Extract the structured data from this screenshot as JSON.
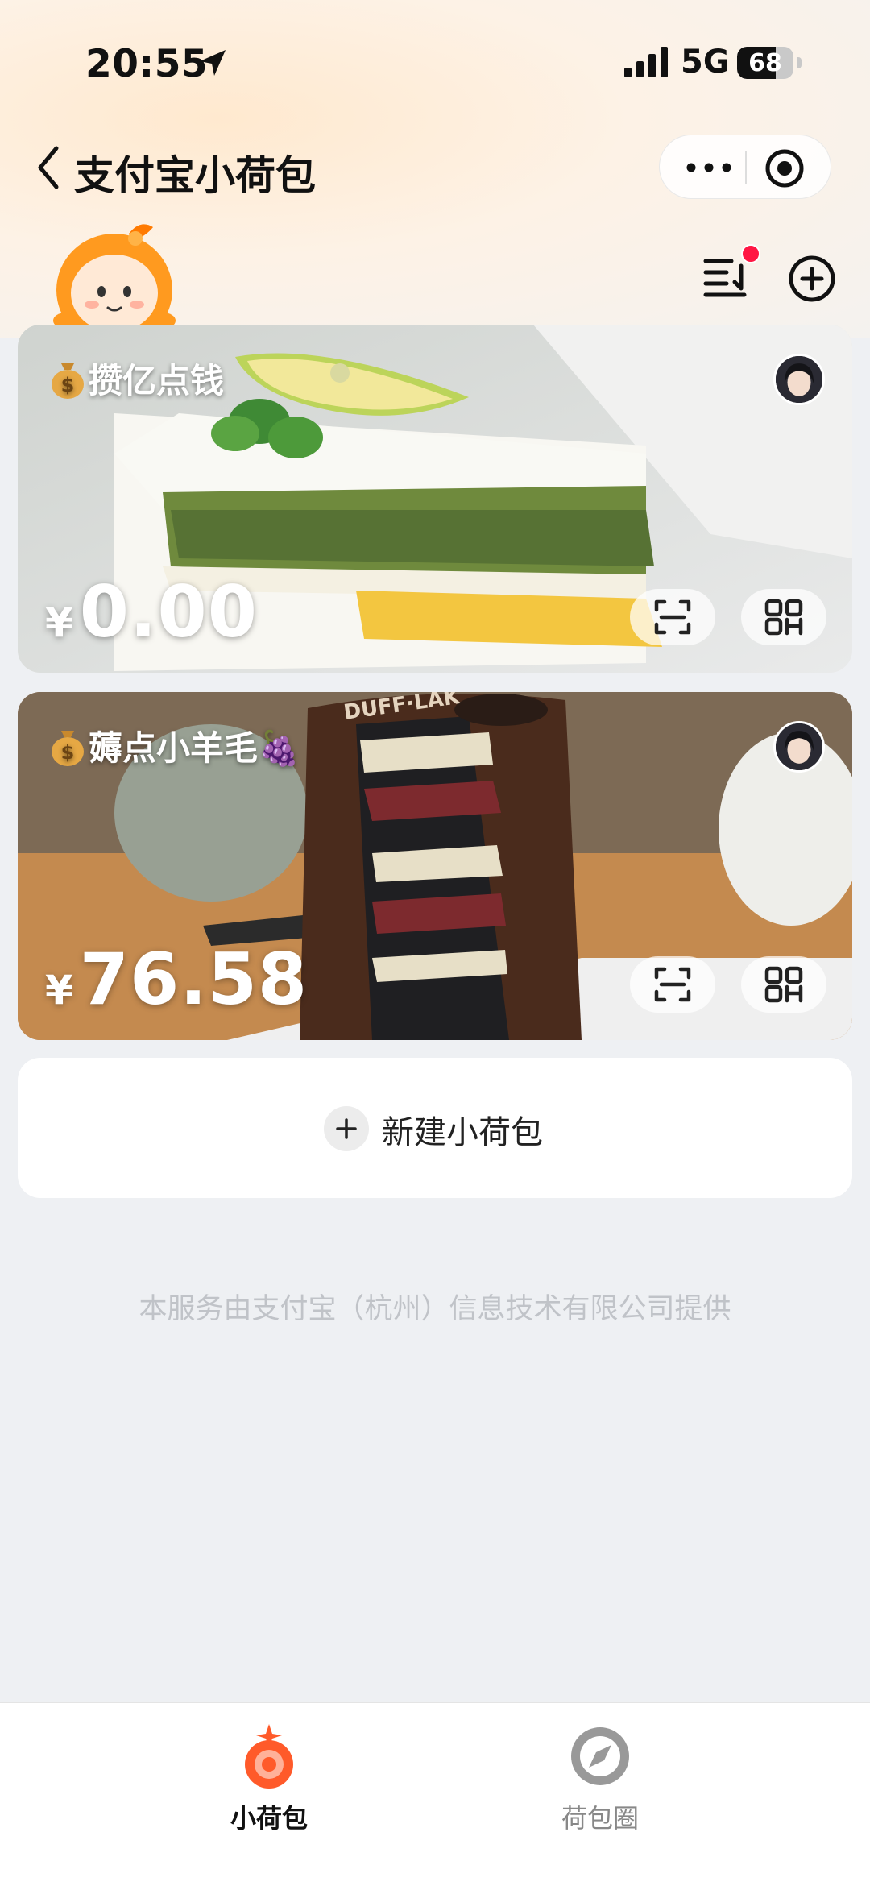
{
  "status_bar": {
    "time": "20:55",
    "network": "5G",
    "battery": "68",
    "battery_level": 0.68
  },
  "nav": {
    "title": "支付宝小荷包",
    "back_icon": "chevron-left-icon",
    "more_icon": "more-dots-icon",
    "close_icon": "target-circle-icon"
  },
  "toolbar": {
    "sort_icon": "sort-list-icon",
    "add_icon": "plus-circle-icon",
    "has_notification": true
  },
  "wallets": [
    {
      "name": "攒亿点钱",
      "currency": "¥",
      "amount": "0.00",
      "art": "green-tea-cake"
    },
    {
      "name": "薅点小羊毛🍇",
      "currency": "¥",
      "amount": "76.58",
      "art": "chocolate-layer-cake",
      "art_text": "DUFF·LAK"
    }
  ],
  "new_wallet": {
    "label": "新建小荷包"
  },
  "footer_note": "本服务由支付宝（杭州）信息技术有限公司提供",
  "tabs": [
    {
      "label": "小荷包",
      "active": true,
      "icon": "wallet-ring-icon"
    },
    {
      "label": "荷包圈",
      "active": false,
      "icon": "compass-icon"
    }
  ],
  "colors": {
    "accent": "#ff5a2a",
    "notification": "#ff1744",
    "background": "#eef0f3"
  }
}
